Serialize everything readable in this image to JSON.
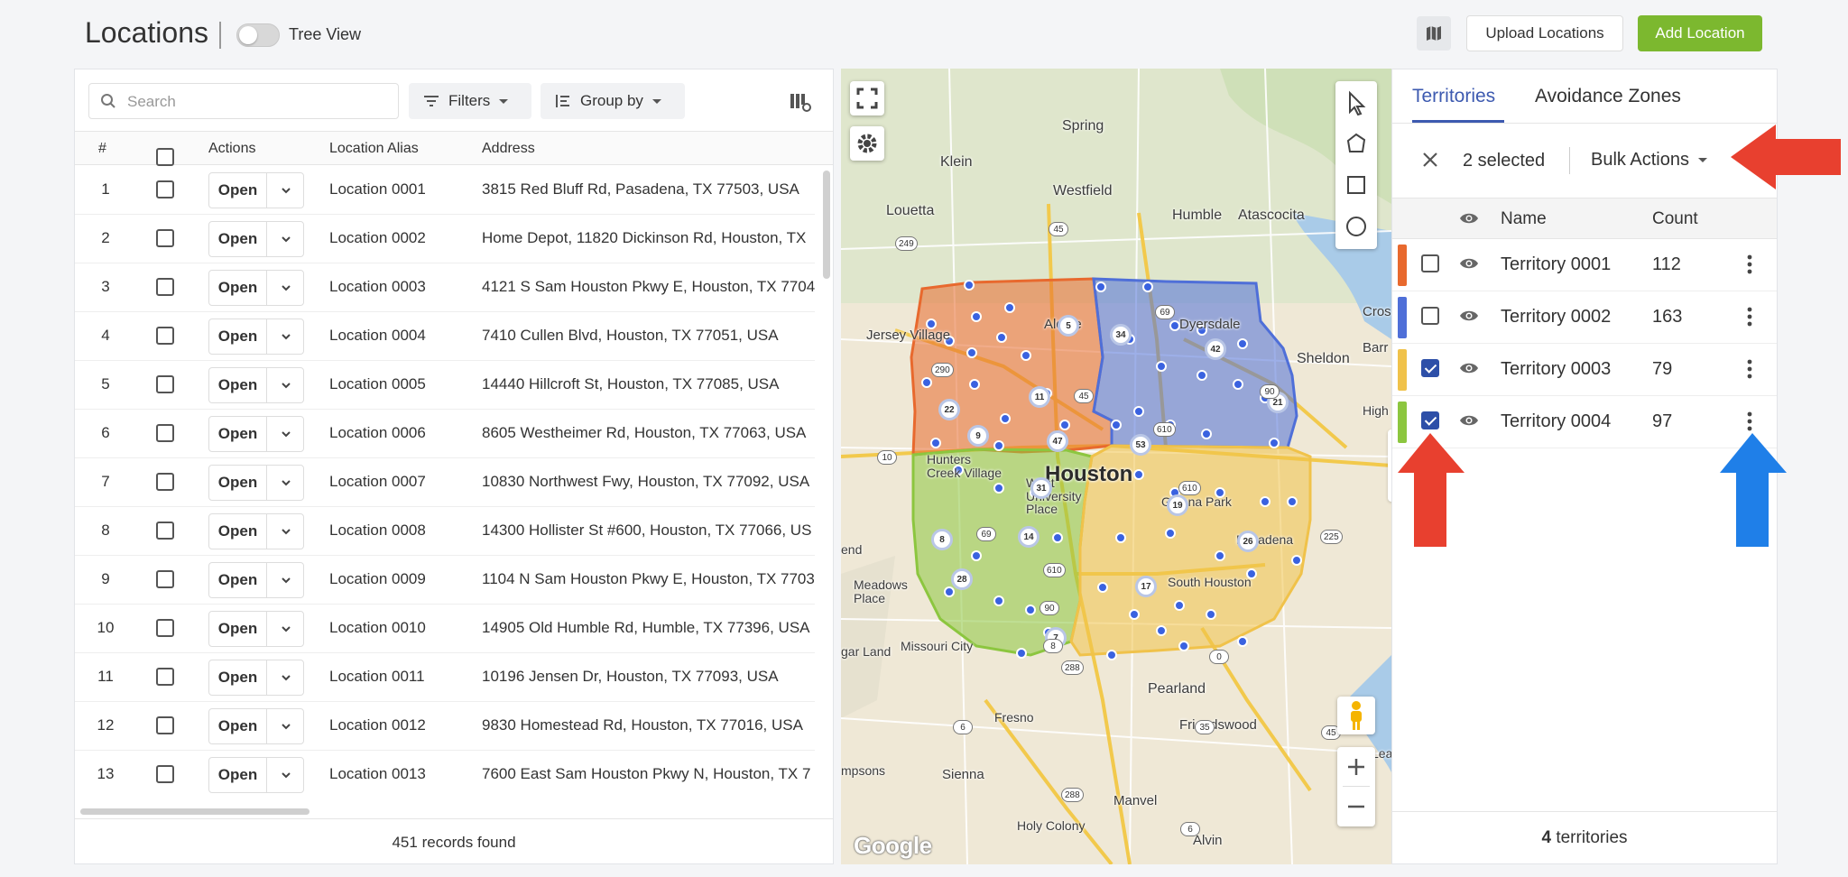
{
  "header": {
    "title": "Locations",
    "tree_view_label": "Tree View",
    "upload_label": "Upload Locations",
    "add_label": "Add Location"
  },
  "toolbar": {
    "search_placeholder": "Search",
    "filters_label": "Filters",
    "group_by_label": "Group by"
  },
  "table": {
    "columns": {
      "num": "#",
      "actions": "Actions",
      "alias": "Location Alias",
      "address": "Address"
    },
    "open_label": "Open",
    "rows": [
      {
        "num": "1",
        "alias": "Location 0001",
        "address": "3815 Red Bluff Rd, Pasadena, TX 77503, USA"
      },
      {
        "num": "2",
        "alias": "Location 0002",
        "address": "Home Depot, 11820 Dickinson Rd, Houston, TX"
      },
      {
        "num": "3",
        "alias": "Location 0003",
        "address": "4121 S Sam Houston Pkwy E, Houston, TX 7704"
      },
      {
        "num": "4",
        "alias": "Location 0004",
        "address": "7410 Cullen Blvd, Houston, TX 77051, USA"
      },
      {
        "num": "5",
        "alias": "Location 0005",
        "address": "14440 Hillcroft St, Houston, TX 77085, USA"
      },
      {
        "num": "6",
        "alias": "Location 0006",
        "address": "8605 Westheimer Rd, Houston, TX 77063, USA"
      },
      {
        "num": "7",
        "alias": "Location 0007",
        "address": "10830 Northwest Fwy, Houston, TX 77092, USA"
      },
      {
        "num": "8",
        "alias": "Location 0008",
        "address": "14300 Hollister St #600, Houston, TX 77066, US"
      },
      {
        "num": "9",
        "alias": "Location 0009",
        "address": "1104 N Sam Houston Pkwy E, Houston, TX 7703"
      },
      {
        "num": "10",
        "alias": "Location 0010",
        "address": "14905 Old Humble Rd, Humble, TX 77396, USA"
      },
      {
        "num": "11",
        "alias": "Location 0011",
        "address": "10196 Jensen Dr, Houston, TX 77093, USA"
      },
      {
        "num": "12",
        "alias": "Location 0012",
        "address": "9830 Homestead Rd, Houston, TX 77016, USA"
      },
      {
        "num": "13",
        "alias": "Location 0013",
        "address": "7600 East Sam Houston Pkwy N, Houston, TX 7"
      }
    ],
    "records_count": "451",
    "records_label": "records found"
  },
  "map": {
    "places": [
      "Spring",
      "Klein",
      "Westfield",
      "Louetta",
      "Humble",
      "Atascocita",
      "Jersey Village",
      "Aldine",
      "Dyersdale",
      "Sheldon",
      "Cros",
      "Barr",
      "High",
      "Hunters Creek Village",
      "Houston",
      "West University Place",
      "Galena Park",
      "Pasadena",
      "end",
      "Meadows Place",
      "South Houston",
      "gar Land",
      "Missouri City",
      "Pearland",
      "Fresno",
      "Friendswood",
      "League City",
      "mpsons",
      "Sienna",
      "Manvel",
      "Holy Colony",
      "Alvin"
    ],
    "cluster_counts": [
      "5",
      "34",
      "42",
      "22",
      "11",
      "9",
      "47",
      "53",
      "21",
      "31",
      "19",
      "8",
      "14",
      "26",
      "28",
      "17",
      "7"
    ],
    "route_shields": [
      "45",
      "249",
      "69",
      "290",
      "45",
      "610",
      "90",
      "10",
      "610",
      "225",
      "69",
      "610",
      "90",
      "8",
      "288",
      "0",
      "6",
      "35",
      "45",
      "288",
      "6"
    ],
    "google_label": "Google"
  },
  "territories": {
    "tabs": [
      "Territories",
      "Avoidance Zones"
    ],
    "selected_text": "2 selected",
    "bulk_actions_label": "Bulk Actions",
    "columns": {
      "name": "Name",
      "count": "Count"
    },
    "rows": [
      {
        "name": "Territory 0001",
        "count": "112",
        "color": "#e8692e",
        "checked": false
      },
      {
        "name": "Territory 0002",
        "count": "163",
        "color": "#4f6fd8",
        "checked": false
      },
      {
        "name": "Territory 0003",
        "count": "79",
        "color": "#f0c24a",
        "checked": true
      },
      {
        "name": "Territory 0004",
        "count": "97",
        "color": "#8cc63f",
        "checked": true
      }
    ],
    "footer_count": "4",
    "footer_label": "territories"
  },
  "colors": {
    "accent": "#3d5ab0",
    "add_button": "#7cb82f",
    "arrow_red": "#e8402f",
    "arrow_blue": "#1f7fe8"
  }
}
